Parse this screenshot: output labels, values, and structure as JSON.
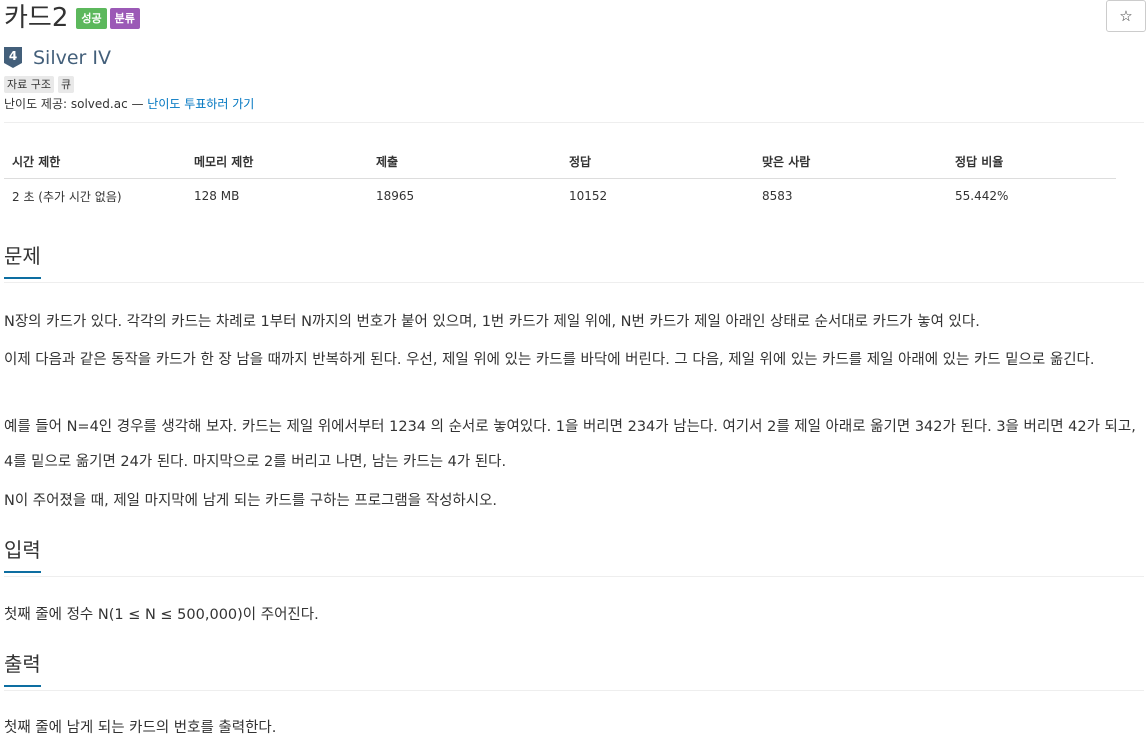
{
  "problem": {
    "title": "카드2",
    "badges": [
      {
        "label": "성공",
        "color": "#5cb85c"
      },
      {
        "label": "분류",
        "color": "#9b59b6"
      }
    ],
    "star_icon": "☆",
    "tier": {
      "number": "4",
      "label": "Silver IV",
      "color": "#435f7a"
    },
    "tags": [
      "자료 구조",
      "큐"
    ],
    "credit_prefix": "난이도 제공: solved.ac — ",
    "credit_link": "난이도 투표하러 가기"
  },
  "stats": {
    "headers": [
      "시간 제한",
      "메모리 제한",
      "제출",
      "정답",
      "맞은 사람",
      "정답 비율"
    ],
    "row": [
      "2 초 (추가 시간 없음)",
      "128 MB",
      "18965",
      "10152",
      "8583",
      "55.442%"
    ]
  },
  "sections": {
    "problem_title": "문제",
    "problem_paragraphs": [
      "N장의 카드가 있다. 각각의 카드는 차례로 1부터 N까지의 번호가 붙어 있으며, 1번 카드가 제일 위에, N번 카드가 제일 아래인 상태로 순서대로 카드가 놓여 있다.",
      "이제 다음과 같은 동작을 카드가 한 장 남을 때까지 반복하게 된다. 우선, 제일 위에 있는 카드를 바닥에 버린다. 그 다음, 제일 위에 있는 카드를 제일 아래에 있는 카드 밑으로 옮긴다.",
      "예를 들어 N=4인 경우를 생각해 보자. 카드는 제일 위에서부터 1234 의 순서로 놓여있다. 1을 버리면 234가 남는다. 여기서 2를 제일 아래로 옮기면 342가 된다. 3을 버리면 42가 되고, 4를 밑으로 옮기면 24가 된다. 마지막으로 2를 버리고 나면, 남는 카드는 4가 된다.",
      "N이 주어졌을 때, 제일 마지막에 남게 되는 카드를 구하는 프로그램을 작성하시오."
    ],
    "input_title": "입력",
    "input_text": "첫째 줄에 정수 N(1 ≤ N ≤ 500,000)이 주어진다.",
    "output_title": "출력",
    "output_text": "첫째 줄에 남게 되는 카드의 번호를 출력한다."
  }
}
